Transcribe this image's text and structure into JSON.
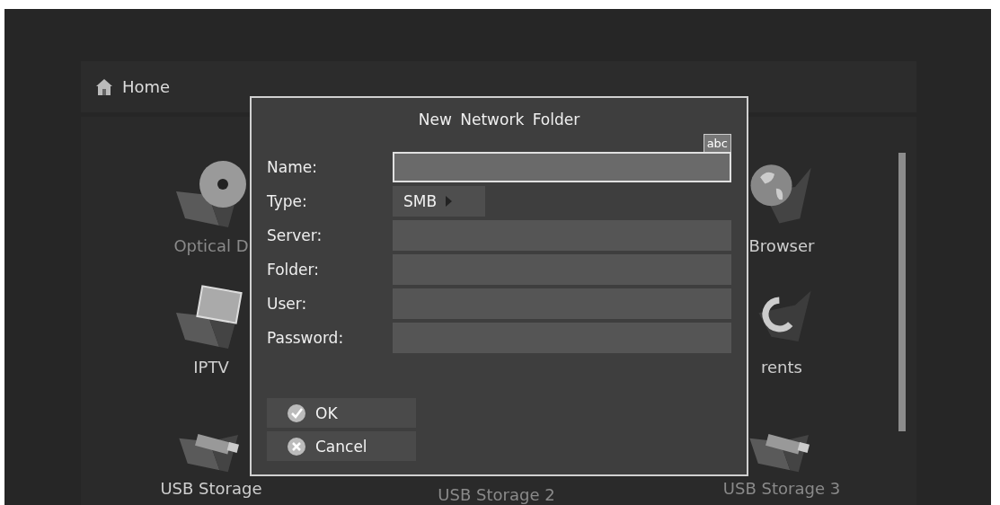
{
  "header": {
    "title": "Home"
  },
  "columns": [
    {
      "tiles": [
        {
          "kind": "disc",
          "label": "Optical D",
          "dimmed": true
        },
        {
          "kind": "ip",
          "label": "IPTV",
          "dimmed": false
        },
        {
          "kind": "usb",
          "label": "USB Storage",
          "dimmed": false
        }
      ]
    },
    {
      "tiles": [
        {
          "kind": "none",
          "label": "USB Storage 2",
          "dimmed": true
        }
      ]
    },
    {
      "tiles": [
        {
          "kind": "globe",
          "label": "Browser",
          "dimmed": false
        },
        {
          "kind": "torrent",
          "label": "rents",
          "dimmed": false
        },
        {
          "kind": "usb",
          "label": "USB Storage 3",
          "dimmed": true
        }
      ]
    }
  ],
  "dialog": {
    "title": "New Network Folder",
    "input_mode": "abc",
    "fields": [
      {
        "label": "Name:",
        "kind": "text",
        "focused": true
      },
      {
        "label": "Type:",
        "kind": "choice",
        "value": "SMB",
        "focused": false
      },
      {
        "label": "Server:",
        "kind": "text",
        "focused": false
      },
      {
        "label": "Folder:",
        "kind": "text",
        "focused": false
      },
      {
        "label": "User:",
        "kind": "text",
        "focused": false
      },
      {
        "label": "Password:",
        "kind": "text",
        "focused": false
      }
    ],
    "buttons": [
      {
        "label": "OK",
        "kind": "ok"
      },
      {
        "label": "Cancel",
        "kind": "cancel"
      }
    ]
  }
}
